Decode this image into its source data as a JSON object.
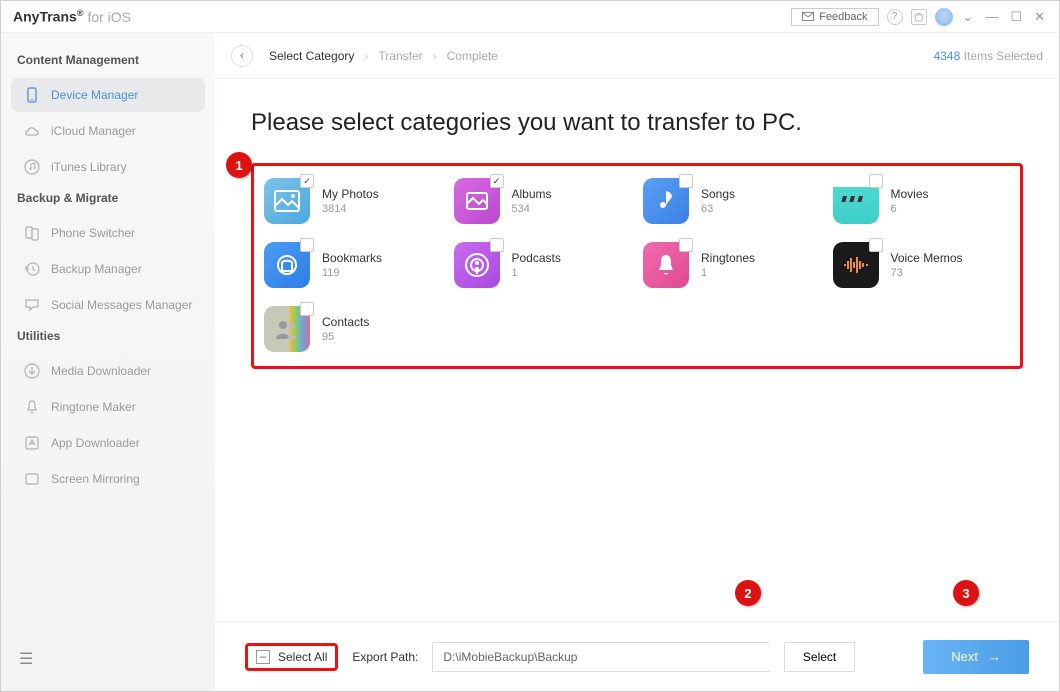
{
  "header": {
    "app_name": "AnyTrans",
    "app_suffix": "for iOS",
    "feedback_label": "Feedback"
  },
  "sidebar": {
    "sections": {
      "content": "Content Management",
      "backup": "Backup & Migrate",
      "utilities": "Utilities"
    },
    "items": {
      "device_manager": "Device Manager",
      "icloud_manager": "iCloud Manager",
      "itunes_library": "iTunes Library",
      "phone_switcher": "Phone Switcher",
      "backup_manager": "Backup Manager",
      "social_messages": "Social Messages Manager",
      "media_downloader": "Media Downloader",
      "ringtone_maker": "Ringtone Maker",
      "app_downloader": "App Downloader",
      "screen_mirroring": "Screen Mirroring"
    }
  },
  "breadcrumb": {
    "step1": "Select Category",
    "step2": "Transfer",
    "step3": "Complete",
    "selected_count": "4348",
    "selected_suffix": " Items Selected"
  },
  "page_title": "Please select categories you want to transfer to PC.",
  "categories": [
    {
      "label": "My Photos",
      "count": "3814",
      "icon": "photos",
      "checked": true
    },
    {
      "label": "Albums",
      "count": "534",
      "icon": "albums",
      "checked": true
    },
    {
      "label": "Songs",
      "count": "63",
      "icon": "songs",
      "checked": false
    },
    {
      "label": "Movies",
      "count": "6",
      "icon": "movies",
      "checked": false
    },
    {
      "label": "Bookmarks",
      "count": "119",
      "icon": "bookmarks",
      "checked": false
    },
    {
      "label": "Podcasts",
      "count": "1",
      "icon": "podcasts",
      "checked": false
    },
    {
      "label": "Ringtones",
      "count": "1",
      "icon": "ringtones",
      "checked": false
    },
    {
      "label": "Voice Memos",
      "count": "73",
      "icon": "voice",
      "checked": false
    },
    {
      "label": "Contacts",
      "count": "95",
      "icon": "contacts",
      "checked": false
    }
  ],
  "footer": {
    "select_all_label": "Select All",
    "export_path_label": "Export Path:",
    "export_path_value": "D:\\iMobieBackup\\Backup",
    "select_button": "Select",
    "next_button": "Next"
  },
  "annotations": {
    "a1": "1",
    "a2": "2",
    "a3": "3"
  }
}
